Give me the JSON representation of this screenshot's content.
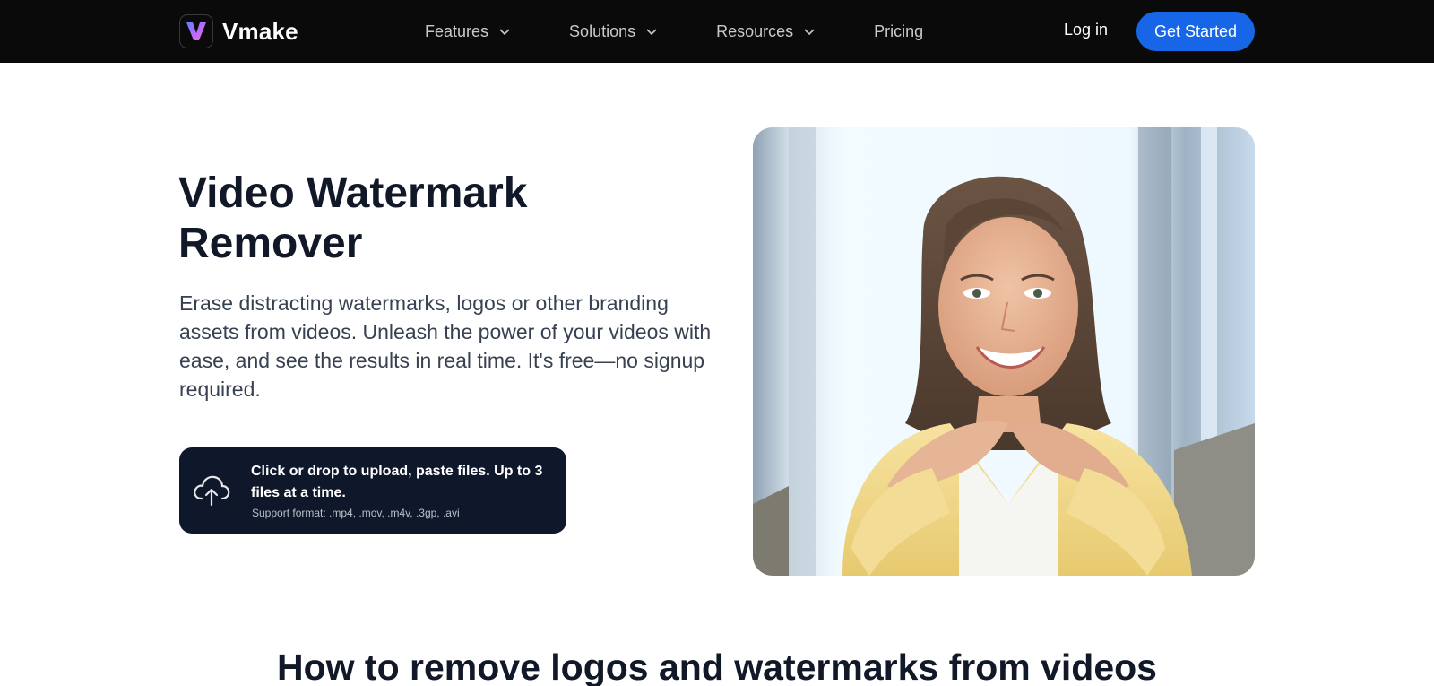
{
  "brand": {
    "name": "Vmake",
    "logo_letter": "V"
  },
  "nav": {
    "items": [
      {
        "label": "Features",
        "has_dropdown": true
      },
      {
        "label": "Solutions",
        "has_dropdown": true
      },
      {
        "label": "Resources",
        "has_dropdown": true
      },
      {
        "label": "Pricing",
        "has_dropdown": false
      }
    ],
    "login_label": "Log in",
    "cta_label": "Get Started"
  },
  "hero": {
    "title": "Video Watermark Remover",
    "description": "Erase distracting watermarks, logos or other branding assets from videos. Unleash the power of your videos with ease, and see the results in real time. It's free—no signup required.",
    "upload": {
      "icon": "cloud-upload-icon",
      "main_text": "Click or drop to upload, paste files. Up to 3 files at a time.",
      "formats_text": "Support format: .mp4, .mov, .m4v, .3gp, .avi"
    }
  },
  "section": {
    "title": "How to remove logos and watermarks from videos"
  },
  "colors": {
    "nav_bg": "#0a0a0a",
    "cta_blue": "#1766e8",
    "upload_bg": "#0f172a",
    "heading": "#111827"
  }
}
